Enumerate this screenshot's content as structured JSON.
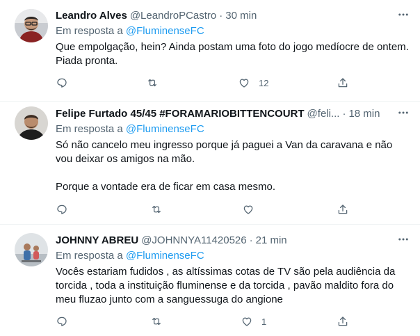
{
  "tweets": [
    {
      "name": "Leandro Alves",
      "handle": "@LeandroPCastro",
      "time": "30 min",
      "reply_prefix": "Em resposta a",
      "reply_to": "@FluminenseFC",
      "paragraphs": [
        "Que empolgação, hein? Ainda postam uma foto do jogo medíocre de ontem. Piada pronta."
      ],
      "likes": "12"
    },
    {
      "name": "Felipe Furtado 45/45 #FORAMARIOBITTENCOURT",
      "handle": "@feli...",
      "time": "18 min",
      "reply_prefix": "Em resposta a",
      "reply_to": "@FluminenseFC",
      "paragraphs": [
        "Só não cancelo meu ingresso porque já paguei a Van da caravana e não vou deixar os amigos na mão.",
        "Porque a vontade era de ficar em casa mesmo."
      ],
      "likes": ""
    },
    {
      "name": "JOHNNY ABREU",
      "handle": "@JOHNNYA11420526",
      "time": "21 min",
      "reply_prefix": "Em resposta a",
      "reply_to": "@FluminenseFC",
      "paragraphs": [
        "Vocês estariam fudidos , as altíssimas cotas de TV são pela audiência da torcida , toda a instituição fluminense e da torcida , pavão maldito fora do meu fluzao junto com a sanguessuga do angione"
      ],
      "likes": "1"
    }
  ],
  "icons": {
    "reply": "reply-icon",
    "retweet": "retweet-icon",
    "like": "like-icon",
    "share": "share-icon",
    "more": "more-icon"
  },
  "colors": {
    "link": "#1d9bf0",
    "secondary": "#536471",
    "text": "#0f1419"
  }
}
